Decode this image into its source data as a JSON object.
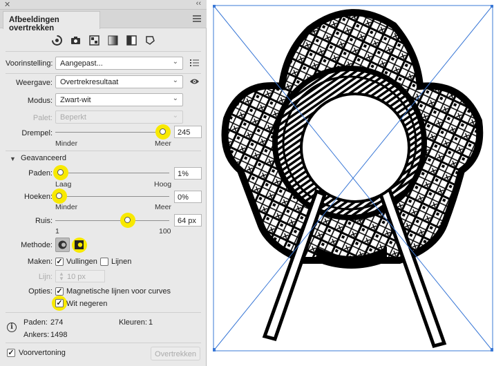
{
  "window": {
    "close_glyph": "✕",
    "collapse_glyph": "‹‹"
  },
  "panel": {
    "tab_title": "Afbeeldingen overtrekken",
    "preset_icons": [
      "auto-color-icon",
      "camera-icon",
      "palette-icon",
      "gradient-icon",
      "half-tone-icon",
      "shape-outline-icon"
    ],
    "preset": {
      "label": "Voorinstelling:",
      "value": "Aangepast..."
    },
    "view": {
      "label": "Weergave:",
      "value": "Overtrekresultaat"
    },
    "mode": {
      "label": "Modus:",
      "value": "Zwart-wit"
    },
    "palette": {
      "label": "Palet:",
      "value": "Beperkt"
    },
    "threshold": {
      "label": "Drempel:",
      "value": "245",
      "min_label": "Minder",
      "max_label": "Meer",
      "level": 0.965
    },
    "advanced_label": "Geavanceerd",
    "paths": {
      "label": "Paden:",
      "value": "1%",
      "min_label": "Laag",
      "max_label": "Hoog",
      "level": 0.01
    },
    "corners": {
      "label": "Hoeken:",
      "value": "0%",
      "min_label": "Minder",
      "max_label": "Meer",
      "level": 0.0
    },
    "noise": {
      "label": "Ruis:",
      "value": "64 px",
      "min_label": "1",
      "max_label": "100",
      "level": 0.64
    },
    "method": {
      "label": "Methode:"
    },
    "create": {
      "label": "Maken:",
      "fills_label": "Vullingen",
      "fills_checked": true,
      "strokes_label": "Lijnen",
      "strokes_checked": false
    },
    "stroke": {
      "label": "Lijn:",
      "value": "10 px"
    },
    "options": {
      "label": "Opties:",
      "snap_label": "Magnetische lijnen voor curves",
      "snap_checked": true,
      "ignore_white_label": "Wit negeren",
      "ignore_white_checked": true
    },
    "stats": {
      "paths_label": "Paden:",
      "paths_value": "274",
      "colors_label": "Kleuren:",
      "colors_value": "1",
      "anchors_label": "Ankers:",
      "anchors_value": "1498"
    },
    "preview": {
      "label": "Voorvertoning",
      "checked": true
    },
    "trace_button": "Overtrekken"
  },
  "colors": {
    "highlight": "#f8e900",
    "selection_blue": "#3a78d6"
  }
}
